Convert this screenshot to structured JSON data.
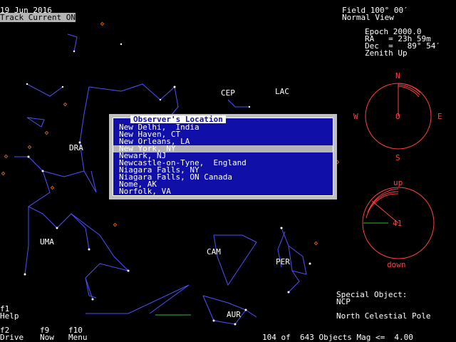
{
  "header": {
    "date": "19 Jun 2016",
    "track_label": "Track Current",
    "track_state": "ON",
    "field": "Field 100° 00′",
    "view": "Normal View",
    "epoch": "Epoch 2000.0",
    "ra": "RA   = 23h 59m",
    "dec": "Dec  =   89° 54′",
    "zenith": "Zenith Up"
  },
  "compass": {
    "n": "N",
    "s": "S",
    "e": "E",
    "w": "W",
    "center": "O",
    "color": "#ff4040"
  },
  "altitude": {
    "up": "up",
    "down": "down",
    "value": "41",
    "color": "#ff4040"
  },
  "constellations": {
    "cep": "CEP",
    "lac": "LAC",
    "dra": "DRA",
    "uma": "UMA",
    "cam": "CAM",
    "per": "PER",
    "aur": "AUR"
  },
  "dialog": {
    "title": "Observer's Location",
    "selected_index": 3,
    "cities": [
      "New Delhi,  India",
      "New Haven, CT",
      "New Orleans, LA",
      "New York, NY",
      "Newark, NJ",
      "Newcastle-on-Tyne,  England",
      "Niagara Falls, NY",
      "Niagara Falls, ON Canada",
      "Nome, AK",
      "Norfolk, VA"
    ]
  },
  "special_object": {
    "label": "Special Object:",
    "code": "NCP",
    "name": "North Celestial Pole"
  },
  "function_keys": {
    "f1_key": "f1",
    "f1_label": "Help",
    "f2_key": "f2",
    "f2_label": "Drive",
    "f9_key": "f9",
    "f9_label": "Now",
    "f10_key": "f10",
    "f10_label": "Menu"
  },
  "status": {
    "objects": "104 of  643 Objects Mag <=  4.00"
  },
  "colors": {
    "constellation_lines": "#5050ff",
    "deep_sky": "#c06020",
    "compass": "#ff4040",
    "dialog_bg": "#1010a8",
    "selection": "#b4b4b4"
  }
}
